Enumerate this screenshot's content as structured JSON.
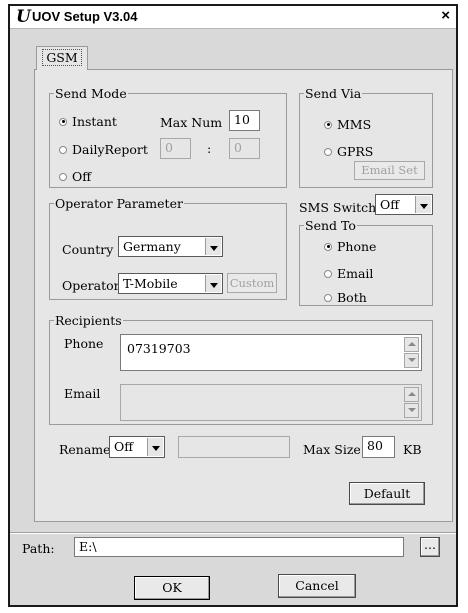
{
  "window": {
    "title": "UOV Setup V3.04",
    "close_glyph": "×",
    "icon": "uov-logo-icon"
  },
  "tabs": [
    {
      "label": "GSM",
      "selected": true
    }
  ],
  "send_mode": {
    "legend": "Send Mode",
    "instant_label": "Instant",
    "max_num_label": "Max Num",
    "max_num_value": "10",
    "daily_report_label": "DailyReport",
    "daily_hour": "0",
    "time_separator": ":",
    "daily_minute": "0",
    "off_label": "Off",
    "selected": "Instant"
  },
  "send_via": {
    "legend": "Send Via",
    "mms_label": "MMS",
    "gprs_label": "GPRS",
    "email_set_label": "Email Set",
    "selected": "MMS"
  },
  "operator": {
    "legend": "Operator Parameter",
    "country_label": "Country",
    "country_value": "Germany",
    "operator_label": "Operator",
    "operator_value": "T-Mobile",
    "custom_label": "Custom"
  },
  "sms_switch": {
    "label": "SMS Switch",
    "value": "Off"
  },
  "send_to": {
    "legend": "Send To",
    "phone_label": "Phone",
    "email_label": "Email",
    "both_label": "Both",
    "selected": "Phone"
  },
  "recipients": {
    "legend": "Recipients",
    "phone_label": "Phone",
    "phone_value": "07319703",
    "email_label": "Email",
    "email_value": ""
  },
  "rename": {
    "label": "Rename",
    "value": "Off",
    "text_value": "",
    "max_size_label": "Max Size",
    "max_size_value": "80",
    "unit": "KB"
  },
  "default_button": "Default",
  "path": {
    "label": "Path:",
    "value": "E:\\",
    "browse_label": "..."
  },
  "buttons": {
    "ok": "OK",
    "cancel": "Cancel"
  }
}
